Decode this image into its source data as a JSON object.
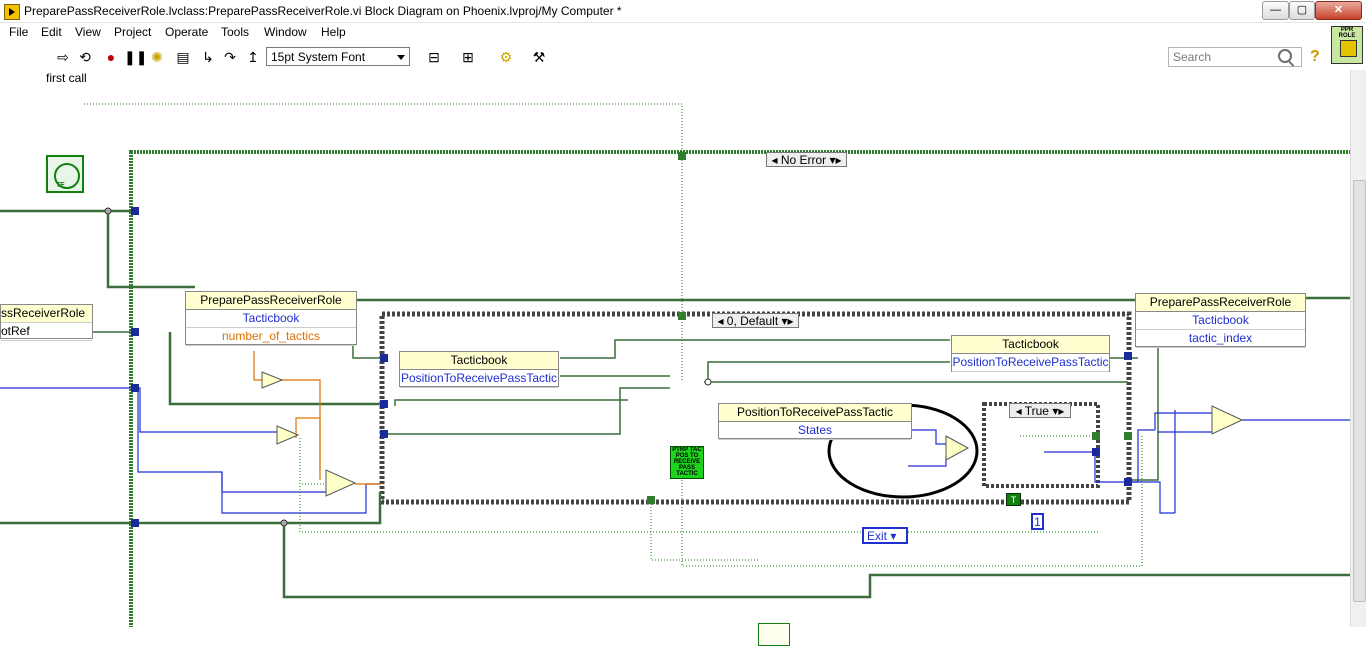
{
  "window": {
    "title": "PreparePassReceiverRole.lvclass:PreparePassReceiverRole.vi Block Diagram on Phoenix.lvproj/My Computer *",
    "controls": {
      "minimize": "—",
      "maximize": "▢",
      "close": "✕"
    }
  },
  "menu": [
    "File",
    "Edit",
    "View",
    "Project",
    "Operate",
    "Tools",
    "Window",
    "Help"
  ],
  "toolbar": {
    "font": "15pt System Font",
    "search_placeholder": "Search",
    "help": "?",
    "vi_icon_label": "PPR ROLE"
  },
  "diagram": {
    "first_call_label": "first call",
    "first_call_tf": "TF",
    "outer_case_selector": "No Error",
    "inner_case_selector": "0, Default",
    "true_case_selector": "True",
    "left_node": {
      "row1": "ssReceiverRole",
      "row2": "otRef"
    },
    "unbundle_left": {
      "title": "PreparePassReceiverRole",
      "row1": "Tacticbook",
      "row2": "number_of_tactics"
    },
    "bundle_right": {
      "title": "PreparePassReceiverRole",
      "row1": "Tacticbook",
      "row2": "tactic_index"
    },
    "tacticbook_left": {
      "title": "Tacticbook",
      "row1": "PositionToReceivePassTactic"
    },
    "tacticbook_right": {
      "title": "Tacticbook",
      "row1": "PositionToReceivePassTactic"
    },
    "position_node": {
      "title": "PositionToReceivePassTactic",
      "row1": "States"
    },
    "exit_enum": "Exit",
    "num_const": "1",
    "bool_const": "T",
    "subvi_text": "PTRP TAC POS TO RECEIVE PASS TACTIC"
  }
}
